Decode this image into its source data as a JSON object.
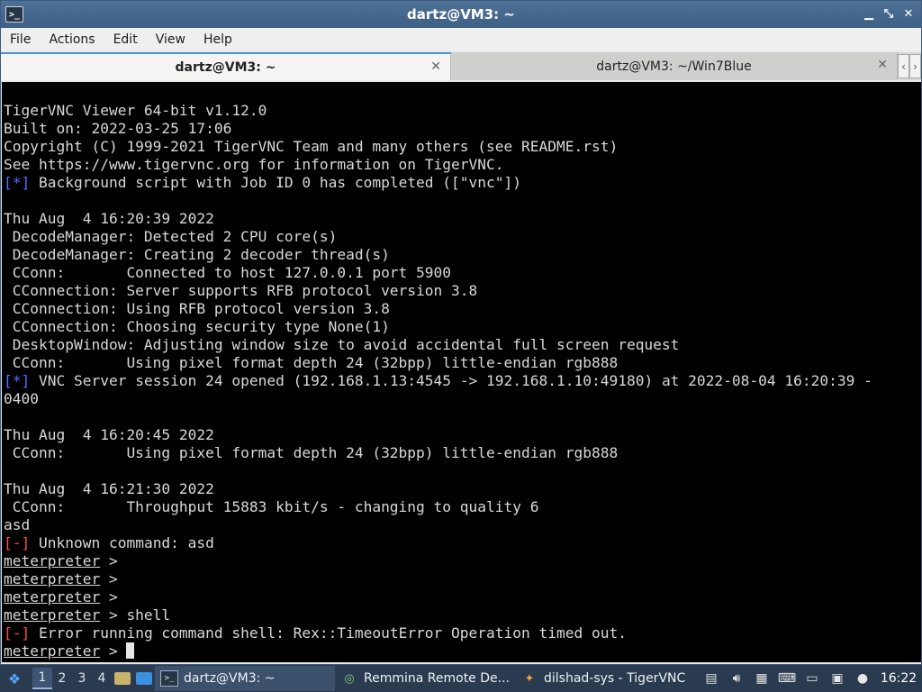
{
  "window": {
    "title": "dartz@VM3: ~",
    "app_icon": "terminal-icon",
    "controls": {
      "minimize": "▁",
      "maximize": "⤡",
      "close": "✕"
    }
  },
  "menu": [
    "File",
    "Actions",
    "Edit",
    "View",
    "Help"
  ],
  "tabs": [
    {
      "label": "dartz@VM3: ~",
      "active": true
    },
    {
      "label": "dartz@VM3: ~/Win7Blue",
      "active": false
    }
  ],
  "terminal": {
    "lines": [
      {
        "segments": [
          {
            "text": "TigerVNC Viewer 64-bit v1.12.0"
          }
        ]
      },
      {
        "segments": [
          {
            "text": "Built on: 2022-03-25 17:06"
          }
        ]
      },
      {
        "segments": [
          {
            "text": "Copyright (C) 1999-2021 TigerVNC Team and many others (see README.rst)"
          }
        ]
      },
      {
        "segments": [
          {
            "text": "See https://www.tigervnc.org for information on TigerVNC."
          }
        ]
      },
      {
        "segments": [
          {
            "text": "[*]",
            "cls": "blue"
          },
          {
            "text": " Background script with Job ID 0 has completed ([\"vnc\"])"
          }
        ]
      },
      {
        "segments": [
          {
            "text": ""
          }
        ]
      },
      {
        "segments": [
          {
            "text": "Thu Aug  4 16:20:39 2022"
          }
        ]
      },
      {
        "segments": [
          {
            "text": " DecodeManager: Detected 2 CPU core(s)"
          }
        ]
      },
      {
        "segments": [
          {
            "text": " DecodeManager: Creating 2 decoder thread(s)"
          }
        ]
      },
      {
        "segments": [
          {
            "text": " CConn:       Connected to host 127.0.0.1 port 5900"
          }
        ]
      },
      {
        "segments": [
          {
            "text": " CConnection: Server supports RFB protocol version 3.8"
          }
        ]
      },
      {
        "segments": [
          {
            "text": " CConnection: Using RFB protocol version 3.8"
          }
        ]
      },
      {
        "segments": [
          {
            "text": " CConnection: Choosing security type None(1)"
          }
        ]
      },
      {
        "segments": [
          {
            "text": " DesktopWindow: Adjusting window size to avoid accidental full screen request"
          }
        ]
      },
      {
        "segments": [
          {
            "text": " CConn:       Using pixel format depth 24 (32bpp) little-endian rgb888"
          }
        ]
      },
      {
        "segments": [
          {
            "text": "[*]",
            "cls": "blue"
          },
          {
            "text": " VNC Server session 24 opened (192.168.1.13:4545 -> 192.168.1.10:49180) at 2022-08-04 16:20:39 -"
          }
        ]
      },
      {
        "segments": [
          {
            "text": "0400"
          }
        ]
      },
      {
        "segments": [
          {
            "text": ""
          }
        ]
      },
      {
        "segments": [
          {
            "text": "Thu Aug  4 16:20:45 2022"
          }
        ]
      },
      {
        "segments": [
          {
            "text": " CConn:       Using pixel format depth 24 (32bpp) little-endian rgb888"
          }
        ]
      },
      {
        "segments": [
          {
            "text": ""
          }
        ]
      },
      {
        "segments": [
          {
            "text": "Thu Aug  4 16:21:30 2022"
          }
        ]
      },
      {
        "segments": [
          {
            "text": " CConn:       Throughput 15883 kbit/s - changing to quality 6"
          }
        ]
      },
      {
        "segments": [
          {
            "text": "asd"
          }
        ]
      },
      {
        "segments": [
          {
            "text": "[-]",
            "cls": "red"
          },
          {
            "text": " Unknown command: asd"
          }
        ]
      },
      {
        "segments": [
          {
            "text": "meterpreter",
            "cls": "u"
          },
          {
            "text": " >"
          }
        ]
      },
      {
        "segments": [
          {
            "text": "meterpreter",
            "cls": "u"
          },
          {
            "text": " >"
          }
        ]
      },
      {
        "segments": [
          {
            "text": "meterpreter",
            "cls": "u"
          },
          {
            "text": " >"
          }
        ]
      },
      {
        "segments": [
          {
            "text": "meterpreter",
            "cls": "u"
          },
          {
            "text": " > shell"
          }
        ]
      },
      {
        "segments": [
          {
            "text": "[-]",
            "cls": "red"
          },
          {
            "text": " Error running command shell: Rex::TimeoutError Operation timed out."
          }
        ]
      },
      {
        "segments": [
          {
            "text": "meterpreter",
            "cls": "u"
          },
          {
            "text": " > "
          }
        ],
        "cursor": true
      }
    ],
    "colors": {
      "background": "#000000",
      "foreground": "#d8d8d8",
      "info": "#5b6bff",
      "error": "#ff4a4a"
    }
  },
  "taskbar": {
    "start_icon": "start-menu-icon",
    "workspaces": [
      {
        "label": "1",
        "active": true
      },
      {
        "label": "2",
        "active": false
      },
      {
        "label": "3",
        "active": false
      },
      {
        "label": "4",
        "active": false
      }
    ],
    "tasks": [
      {
        "label": "dartz@VM3: ~",
        "icon": "terminal-icon",
        "active": true
      },
      {
        "label": "Remmina Remote De...",
        "icon": "remmina-icon",
        "active": false
      },
      {
        "label": "dilshad-sys - TigerVNC",
        "icon": "tigervnc-icon",
        "active": false
      }
    ],
    "clock": "16:22"
  }
}
